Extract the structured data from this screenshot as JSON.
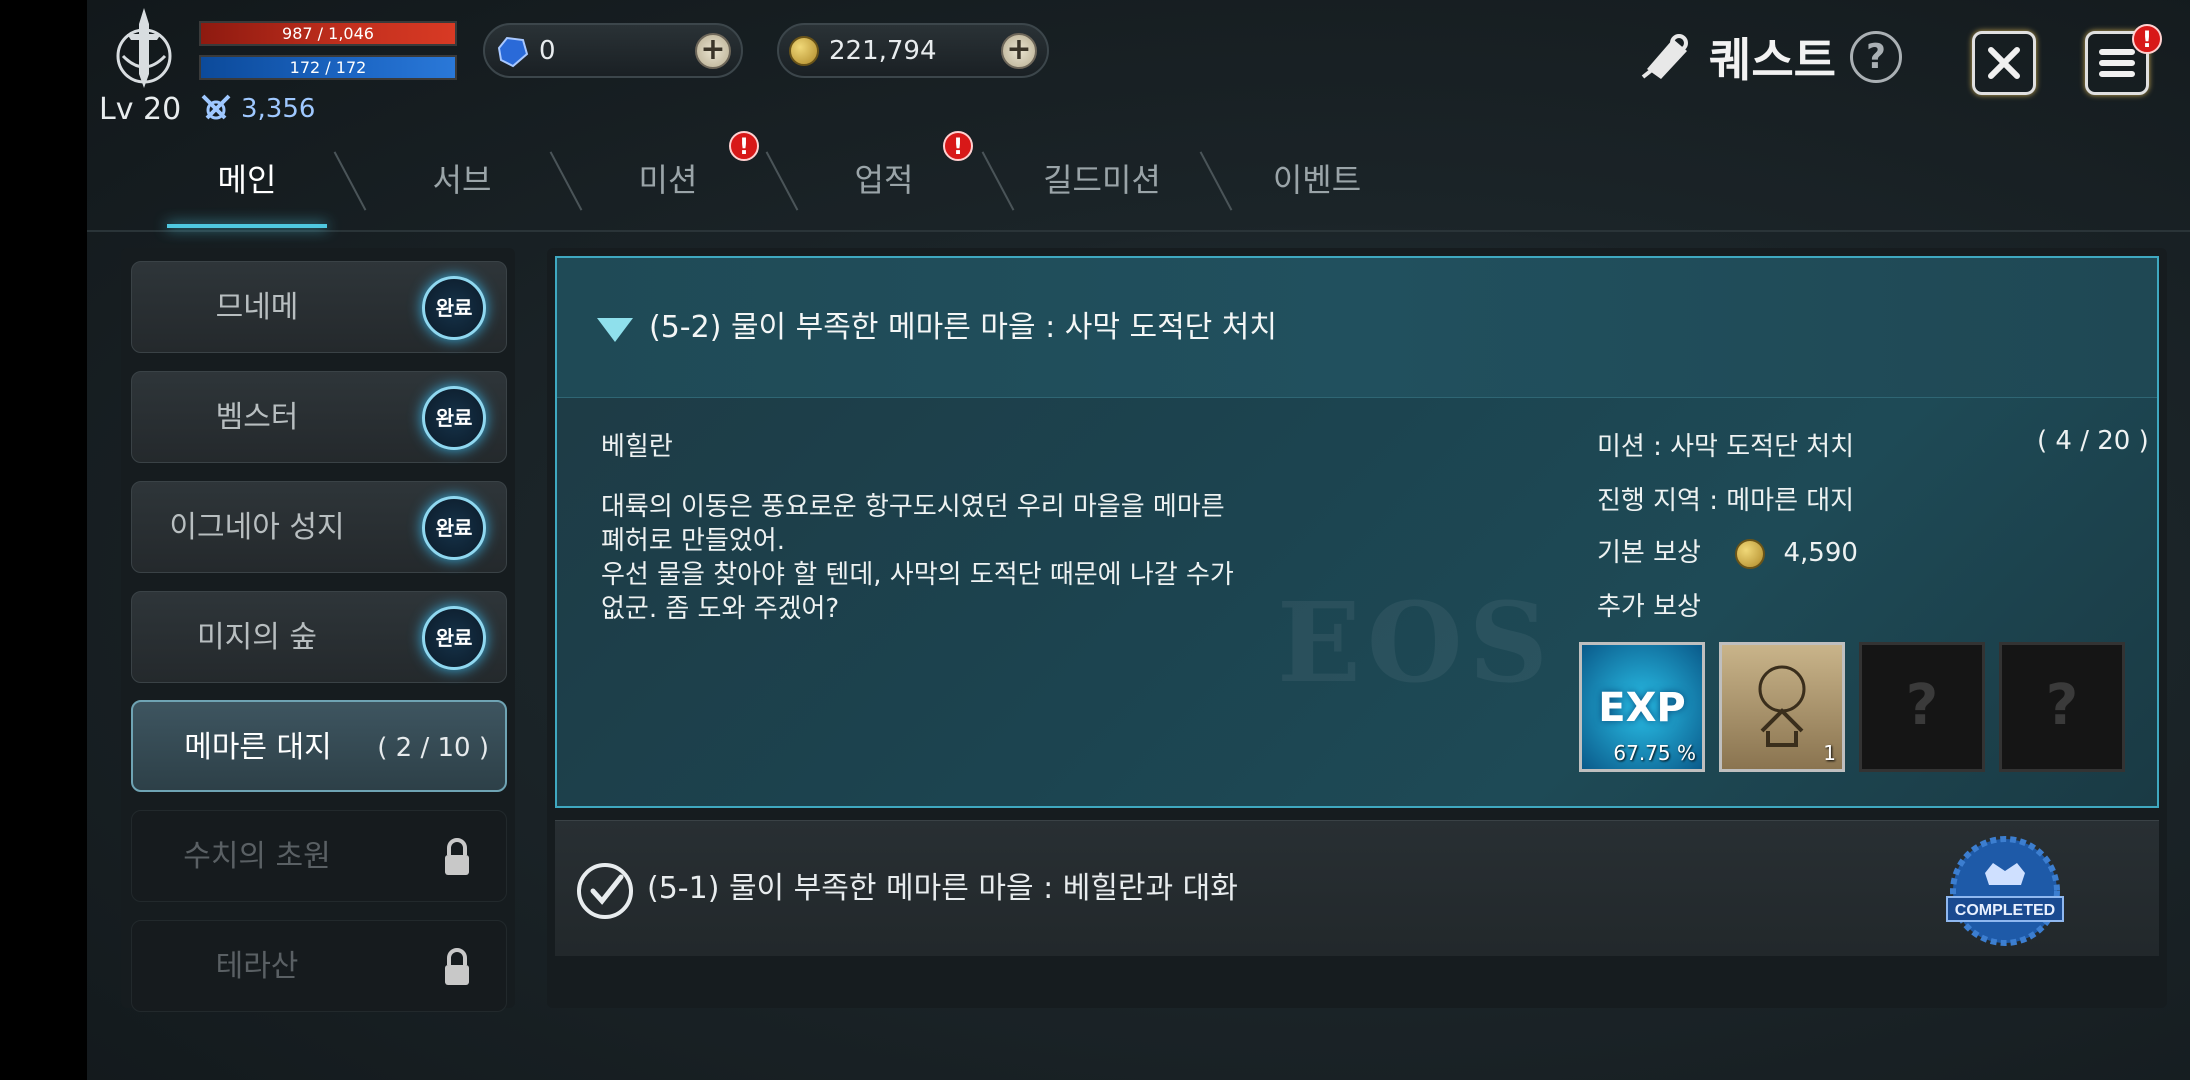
{
  "player": {
    "level": "Lv 20",
    "hp": "987 / 1,046",
    "mp": "172 / 172",
    "combat_power": "3,356"
  },
  "currency": {
    "gem": "0",
    "gold": "221,794"
  },
  "header": {
    "title": "퀘스트",
    "help_icon": "question-icon",
    "close_icon": "close-icon",
    "menu_icon": "menu-icon",
    "alert_mark": "!"
  },
  "tabs": [
    {
      "label": "메인",
      "active": true
    },
    {
      "label": "서브"
    },
    {
      "label": "미션",
      "alert": "!"
    },
    {
      "label": "업적",
      "alert": "!"
    },
    {
      "label": "길드미션"
    },
    {
      "label": "이벤트"
    }
  ],
  "regions": [
    {
      "name": "므네메",
      "status": "완료"
    },
    {
      "name": "벰스터",
      "status": "완료"
    },
    {
      "name": "이그네아 성지",
      "status": "완료"
    },
    {
      "name": "미지의 숲",
      "status": "완료"
    },
    {
      "name": "메마른 대지",
      "progress": "( 2 / 10 )",
      "active": true
    },
    {
      "name": "수치의 초원",
      "locked": true
    },
    {
      "name": "테라산",
      "locked": true
    }
  ],
  "current_quest": {
    "title": "(5-2) 물이 부족한 메마른 마을 : 사막 도적단 처치",
    "npc": "베힐란",
    "dialog": "대륙의 이동은 풍요로운 항구도시였던 우리 마을을 메마른\n폐허로 만들었어.\n우선 물을 찾아야 할 텐데, 사막의 도적단 때문에 나갈 수가\n없군. 좀 도와 주겠어?",
    "mission": "미션 : 사막 도적단 처치",
    "mission_count": "( 4 / 20 )",
    "region": "진행 지역 : 메마른 대지",
    "base_reward_label": "기본 보상",
    "base_reward_value": "4,590",
    "extra_reward_label": "추가 보상",
    "rewards": [
      {
        "type": "exp",
        "label": "EXP",
        "sub": "67.75 %"
      },
      {
        "type": "scroll",
        "icon": "scroll-icon",
        "sub": "1"
      },
      {
        "type": "empty",
        "icon": "mystery-box-icon"
      },
      {
        "type": "empty",
        "icon": "mystery-box-icon"
      }
    ]
  },
  "completed_quest": {
    "title": "(5-1) 물이 부족한 메마른 마을 : 베힐란과 대화",
    "stamp": "COMPLETED"
  },
  "colors": {
    "accent": "#4fc8e0",
    "hp": "#c4301e",
    "mp": "#1c66c4",
    "alert": "#d81818"
  }
}
